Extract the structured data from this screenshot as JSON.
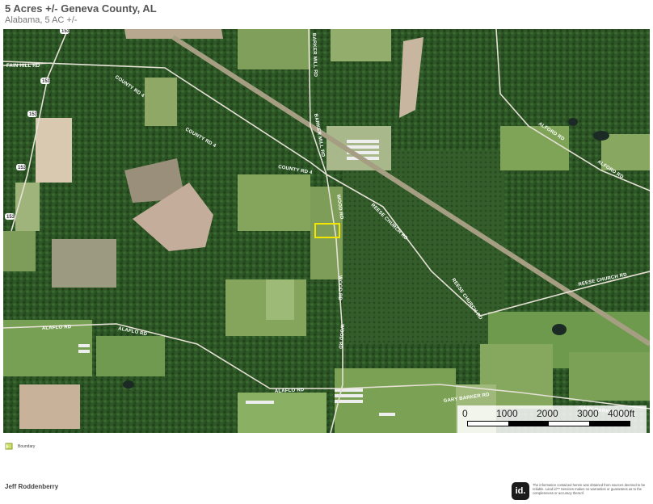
{
  "header": {
    "title": "5 Acres +/- Geneva County, AL",
    "subtitle": "Alabama, 5 AC +/-"
  },
  "map": {
    "road_labels": {
      "fain_hill": "FAIN HILL RD",
      "county_rd_4": "COUNTY RD 4",
      "barker_mill": "BARKER MILL RD",
      "wood_rd": "WOOD RD",
      "reese_church": "REESE CHURCH RD",
      "alford": "ALFORD RD",
      "alaflo": "ALAFLO RD",
      "gary_barker": "GARY BARKER RD"
    },
    "highway_shields": [
      "153",
      "153",
      "153",
      "153",
      "153"
    ],
    "scale": {
      "ticks": [
        "0",
        "1000",
        "2000",
        "3000",
        "4000ft"
      ]
    }
  },
  "legend": {
    "label": "Boundary"
  },
  "footer": {
    "agent_name": "Jeff Roddenberry",
    "logo_text": "id.",
    "disclaimer": "The information contained herein was obtained from sources deemed to be reliable. Land id™ Services makes no warranties or guarantees as to the completeness or accuracy thereof."
  },
  "colors": {
    "boundary": "#f2e600",
    "forest": "#2f5a2a",
    "field": "#86a55c"
  }
}
